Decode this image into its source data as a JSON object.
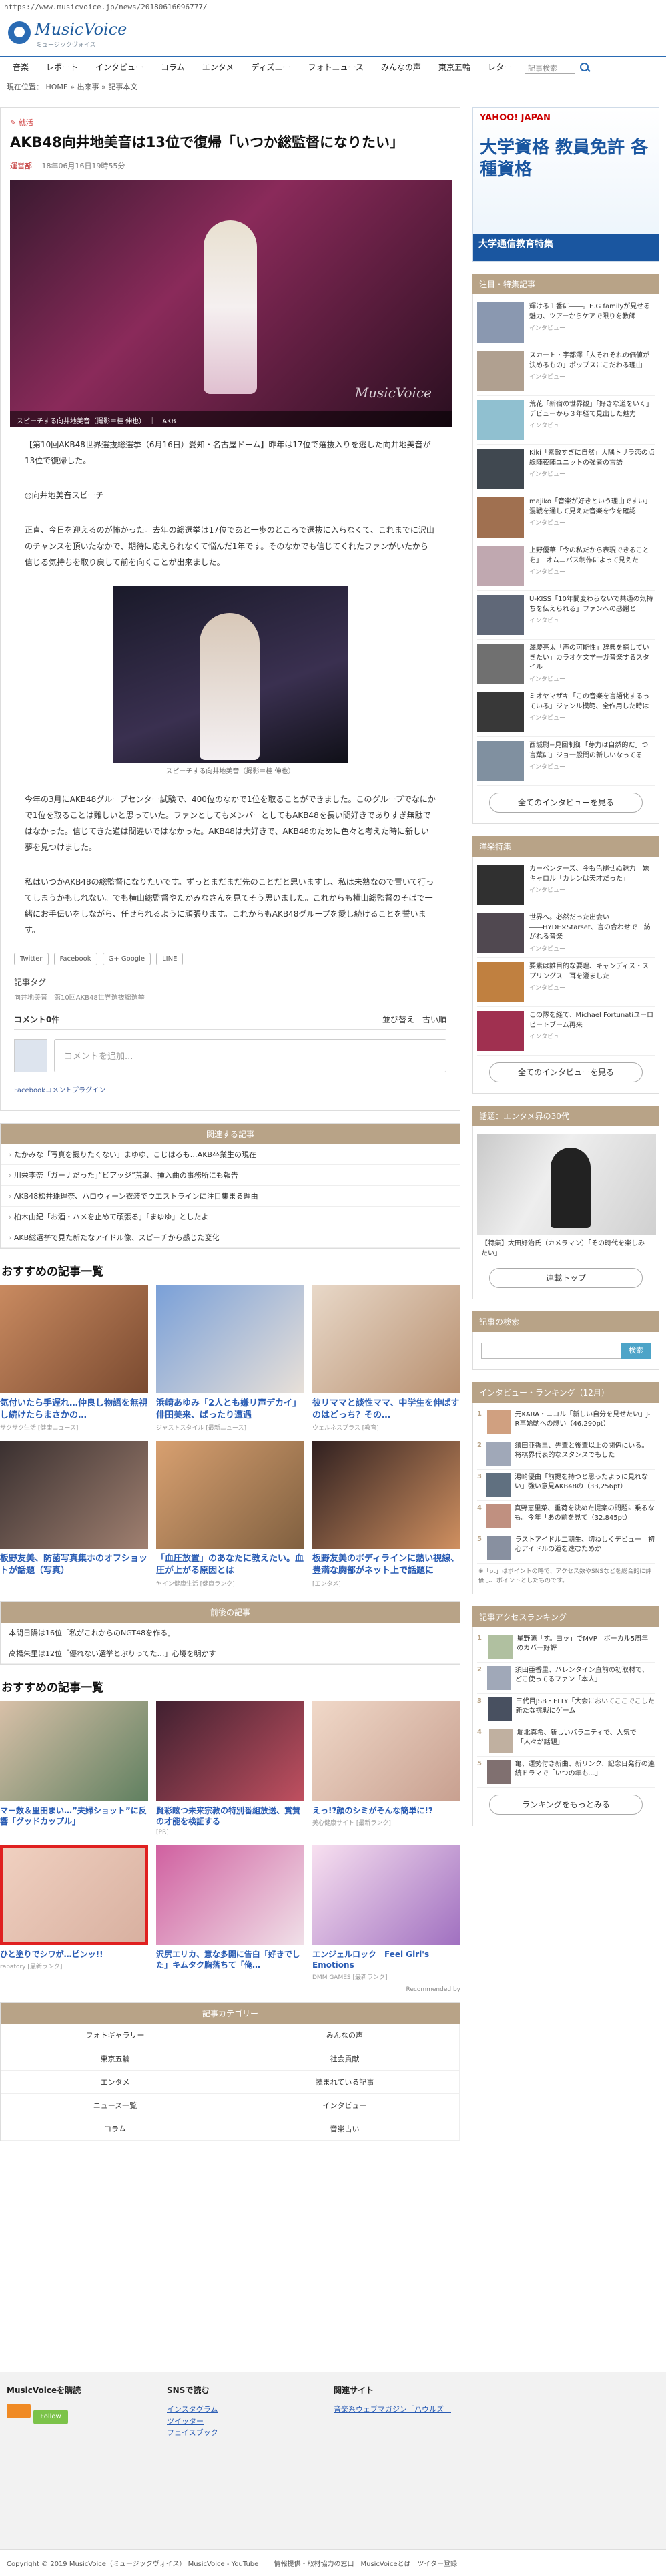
{
  "url": "https://www.musicvoice.jp/news/20180616096777/",
  "logo": {
    "name": "MusicVoice",
    "tagline": "ミュージックヴォイス"
  },
  "nav": [
    "音楽",
    "レポート",
    "インタビュー",
    "コラム",
    "エンタメ",
    "ディズニー",
    "フォトニュース",
    "みんなの声",
    "東京五輪",
    "レター"
  ],
  "search": {
    "placeholder": "記事検索"
  },
  "breadcrumb": "現在位置： HOME » 出来事 » 記事本文",
  "article": {
    "category": "就活",
    "title": "AKB48向井地美音は13位で復帰「いつか総監督になりたい」",
    "author": "運営部",
    "date": "18年06月16日19時55分",
    "photo_caption": "スピーチする向井地美音（撮影＝桂 伸也）",
    "photo_credit": "AKB",
    "watermark": "MusicVoice",
    "lead": "【第10回AKB48世界選抜総選挙（6月16日）愛知・名古屋ドーム】昨年は17位で選抜入りを逃した向井地美音が13位で復帰した。",
    "speech_heading": "◎向井地美音スピーチ",
    "body1": "正直、今日を迎えるのが怖かった。去年の総選挙は17位であと一歩のところで選抜に入らなくて、これまでに沢山のチャンスを頂いたなかで、期待に応えられなくて悩んだ1年です。そのなかでも信じてくれたファンがいたから信じる気持ちを取り戻して前を向くことが出来ました。",
    "photo2_caption": "スピーチする向井地美音（撮影＝桂 伸也）",
    "body2": "今年の3月にAKB48グループセンター試験で、400位のなかで1位を取ることができました。このグループでなにかで1位を取ることは難しいと思っていた。ファンとしてもメンバーとしてもAKB48を長い間好きでありすぎ無駄ではなかった。信じてきた道は間違いではなかった。AKB48は大好きで、AKB48のために色々と考えた時に新しい夢を見つけました。",
    "body3": "私はいつかAKB48の総監督になりたいです。ずっとまだまだ先のことだと思いますし、私は未熟なので置いて行ってしまうかもしれない。でも横山総監督やたかみなさんを見てそう思いました。これからも横山総監督のそばで一緒にお手伝いをしながら、任せられるように頑張ります。これからもAKB48グループを愛し続けることを誓います。",
    "share": [
      "Twitter",
      "Facebook",
      "G+ Google",
      "LINE"
    ],
    "tags_label": "記事タグ",
    "tags": "向井地美音　第10回AKB48世界選抜総選挙"
  },
  "comments": {
    "count_label": "コメント0件",
    "sort_label": "並び替え",
    "sort_value": "古い順",
    "placeholder": "コメントを追加...",
    "fb_plugin": "Facebookコメントプラグイン"
  },
  "related": {
    "heading": "関連する記事",
    "items": [
      "たかみな「写真を撮りたくない」まゆゆ、こじはるも…AKB卒業生の現在",
      "川栄李奈「ガーナだった」”ビアッジ”荒瀬、挿入曲の事務所にも報告",
      "AKB48松井珠理奈、ハロウィーン衣装でウエストラインに注目集まる理由",
      "柏木由紀「お酒・ハメを止めて頑張る」「まゆゆ」としたよ",
      "AKB総選挙で見た新たなアイドル像、スピーチから感じた変化"
    ]
  },
  "recommend1": {
    "heading": "おすすめの記事一覧",
    "cards": [
      {
        "title": "気付いたら手遅れ…仲良し物語を無視し続けたらまさかの…",
        "src": "サクサク生活 [健康ニュース]"
      },
      {
        "title": "浜崎あゆみ「2人とも嫌リ声デカイ」俳田美来、ばったり遭遇",
        "src": "ジャストスタイル [最新ニュース]"
      },
      {
        "title": "彼リママと談性ママ、中学生を伸ばすのはどっち？その…",
        "src": "ウェルネスプラス [教育]"
      },
      {
        "title": "板野友美、防菌写真集ホのオフショットが話題（写真）",
        "src": ""
      },
      {
        "title": "「血圧放置」のあなたに教えたい。血圧が上がる原因とは",
        "src": "ヤイン健康生活 [健康ランク]"
      },
      {
        "title": "板野友美のボディラインに熱い視線、豊満な胸部がネット上で話題に",
        "src": "[エンタメ]"
      }
    ]
  },
  "prev": {
    "heading": "前後の記事",
    "items": [
      "本間日陽は16位「私がこれからのNGT48を作る」",
      "高橋朱里は12位「優れない選挙とぶりってた…」心境を明かす"
    ]
  },
  "recommend2": {
    "heading": "おすすめの記事一覧",
    "cards": [
      {
        "title": "マー数＆里田まい…”夫婦ショット”に反響「グッドカップル」",
        "src": ""
      },
      {
        "title": "賢彩眩つ未来宗教の特別番組放送、賞賛の才能を検証する",
        "src": "[PR]"
      },
      {
        "title": "えっ!?顔のシミがそんな簡単に!?",
        "src": "美心健康サイト [最新ランク]"
      },
      {
        "title": "ひと塗りでシワが…ピンッ!!",
        "src": "rapatory [最新ランク]"
      },
      {
        "title": "沢尻エリカ、意な多開に告白「好きでした」キムタク胸落ちて「俺…",
        "src": ""
      },
      {
        "title": "エンジェルロック　Feel Girl's Emotions",
        "src": "DMM GAMES [最新ランク]"
      }
    ],
    "ad_label": "Recommended by"
  },
  "categories": {
    "heading": "記事カテゴリー",
    "items": [
      "フォトギャラリー",
      "みんなの声",
      "東京五輪",
      "社会貢献",
      "エンタメ",
      "読まれている記事",
      "ニュース一覧",
      "インタビュー",
      "コラム",
      "音楽占い"
    ]
  },
  "ad": {
    "brand": "YAHOO! JAPAN",
    "headline": "大学資格 教員免許 各種資格",
    "bottom": "大学通信教育特集"
  },
  "sidebar": {
    "attention_heading": "注目・特集記事",
    "attention": [
      {
        "t": "輝ける１番に――。E.G familyが見せる魅力、ツアーからケアで限りを教師",
        "d": "インタビュー"
      },
      {
        "t": "スカート・宇都澤「人それぞれの価値が決めるもの」ポップスにこだわる理由",
        "d": "インタビュー"
      },
      {
        "t": "荒花「新宿の世界観」「好きな道をいく」デビューから３年経て見出した魅力",
        "d": "インタビュー"
      },
      {
        "t": "Kiki「素敵すぎに自然」大隅トリラ恋の点線陣夜陣ユニットの強者の言語",
        "d": "インタビュー"
      },
      {
        "t": "majiko「音楽が好きという理由ですい」混戦を通して見えた音楽を今を確認",
        "d": "インタビュー"
      },
      {
        "t": "上野優華「今の私だから表現できることを」　オムニバス制作によって見えた",
        "d": "インタビュー"
      },
      {
        "t": "U-KISS「10年間変わらないで共通の気持ちを伝えられる」ファンへの感謝と",
        "d": "インタビュー"
      },
      {
        "t": "澤慶亮太「声の可能性」辞典を探していきたい」カラオケ文学一ガ音楽するスタイル",
        "d": "インタビュー"
      },
      {
        "t": "ミオヤマザキ「この音楽を言語化するっている」ジャンル模範、全作用した時は",
        "d": "インタビュー"
      },
      {
        "t": "西城尉=見回制御「芽力は自然的だ」つ言葉に」ジョ一般聞の新しいなってる",
        "d": "インタビュー"
      }
    ],
    "all_interview": "全てのインタビューを見る",
    "special_heading": "洋楽特集",
    "special": [
      {
        "t": "カーペンターズ、今も色褪せぬ魅力　妹キャロル「カレンは天才だった」",
        "d": "インタビュー"
      },
      {
        "t": "世界へ。必然だった出会い――HYDE×Starset、言の合わせで　紡がれる音楽",
        "d": "インタビュー"
      },
      {
        "t": "要素は誰目的な要理、キャンディス・スプリングス　耳を澄ました",
        "d": "インタビュー"
      },
      {
        "t": "この隊を経て、Michael Fortunatiユーロビートブーム再来",
        "d": "インタビュー"
      }
    ],
    "topic_heading": "話題：エンタメ界の30代",
    "topic_caption": "【特集】大田好治氏（カメラマン）「その時代を楽しみたい」",
    "topic_link": "連載トップ",
    "search_heading": "記事の検索",
    "search_btn": "検索",
    "ranking_heading": "インタビュー・ランキング（12月）",
    "ranking": [
      {
        "t": "元KARA・ニコル「新しい自分を見せたい」J-R再始動への想い（46,290pt）"
      },
      {
        "t": "須田亜香里、先輩と後輩以上の関係にいる。将棋界代表的なスタンスでもした"
      },
      {
        "t": "湯崎優由「前提を持つと思ったように見れない」強い意見AKB48の（33,256pt）"
      },
      {
        "t": "真野恵里菜、重荷を決めた提案の問題に乗るなも。今年「あの前を見て（32,845pt）"
      },
      {
        "t": "ラストアイドル二期生、切ねしくデビュー　初心アイドルの道を進むためか"
      }
    ],
    "ranking_note": "※「pt」はポイントの略で、アクセス数やSNSなどを総合的に評価し、ポイントとしたものです。",
    "access_heading": "記事アクセスランキング",
    "access": [
      {
        "t": "星野源「す。ヨッ」でMVP　ボーカル5周年のカバー好評"
      },
      {
        "t": "須田亜香里、バレンタイン直前の初取材で、どこ使ってるファン「本人」"
      },
      {
        "t": "三代目JSB・ELLY「大会においてここでこした新たな挑戦にゲーム"
      },
      {
        "t": "堀北真希、新しいバラエティで、人気で「人々が話題」"
      },
      {
        "t": "亀、運勢付き新曲、新リンク、記念日発行の連続ドラマで「いつの年も…」"
      }
    ],
    "ranking_more": "ランキングをもっとみる"
  },
  "footer": {
    "col1_title": "MusicVoiceを購読",
    "follow": "Follow",
    "col2_title": "SNSで読む",
    "col2_links": [
      "インスタグラム",
      "ツイッター",
      "フェイスブック"
    ],
    "col3_title": "関連サイト",
    "col3_links": [
      "音楽系ウェブマガジン「ハウルズ」"
    ],
    "copyright": "Copyright © 2019 MusicVoice（ミュージックヴォイス） MusicVoice - YouTube",
    "links": "情報提供・取材協力の窓口　MusicVoiceとは　ツイター登録"
  },
  "colors": {
    "accent": "#2a6bb4",
    "section": "#b8a387",
    "link": "#2a5cb4",
    "alert": "#d04040"
  }
}
